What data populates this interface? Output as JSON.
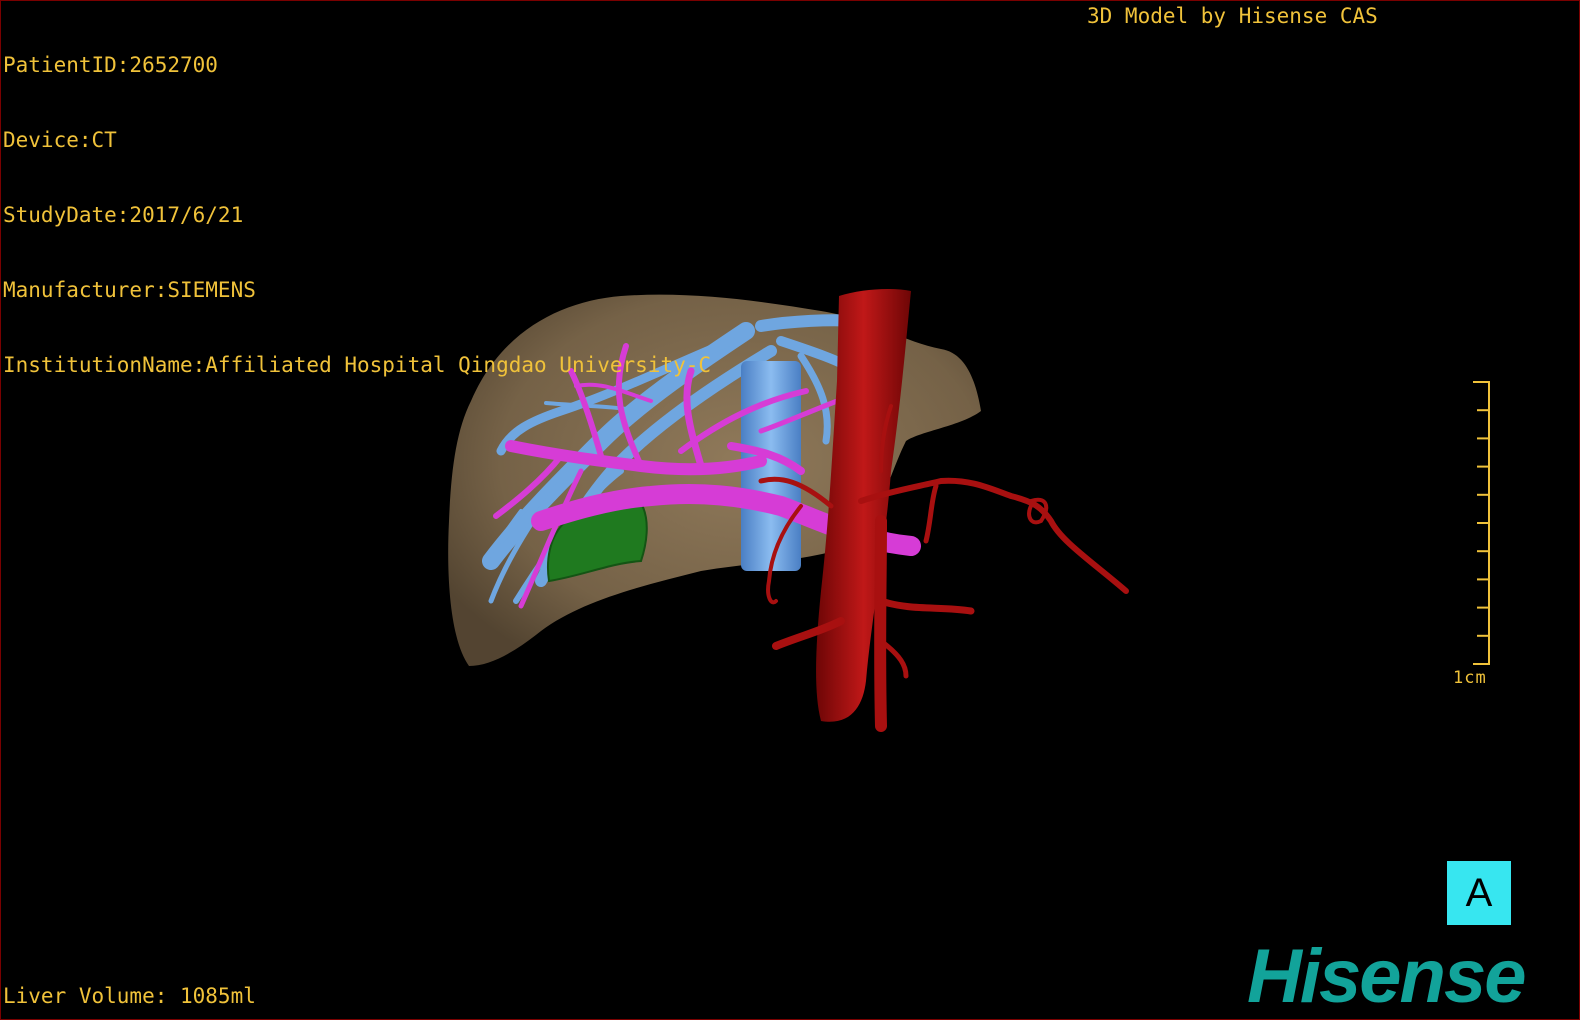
{
  "dicom_info": {
    "patient_id": "PatientID:2652700",
    "device": "Device:CT",
    "study_date": "StudyDate:2017/6/21",
    "manufacturer": "Manufacturer:SIEMENS",
    "institution": "InstitutionName:Affiliated Hospital Qingdao University-C"
  },
  "credit": "3D Model by Hisense CAS",
  "liver_volume": "Liver Volume: 1085ml",
  "scale_bar": {
    "label": "1cm",
    "ticks": 10
  },
  "view_badge": "A",
  "logo": "Hisense",
  "colors": {
    "overlay_text": "#f0c23a",
    "liver": "#8a7456",
    "hepatic_vein": "#6fa6e0",
    "portal_vein": "#d63cd6",
    "artery_ivc": "#a81010",
    "gallbladder": "#1f7a1f",
    "badge": "#37e6f0",
    "logo": "#12a39a",
    "viewport_border": "#7a0000"
  }
}
